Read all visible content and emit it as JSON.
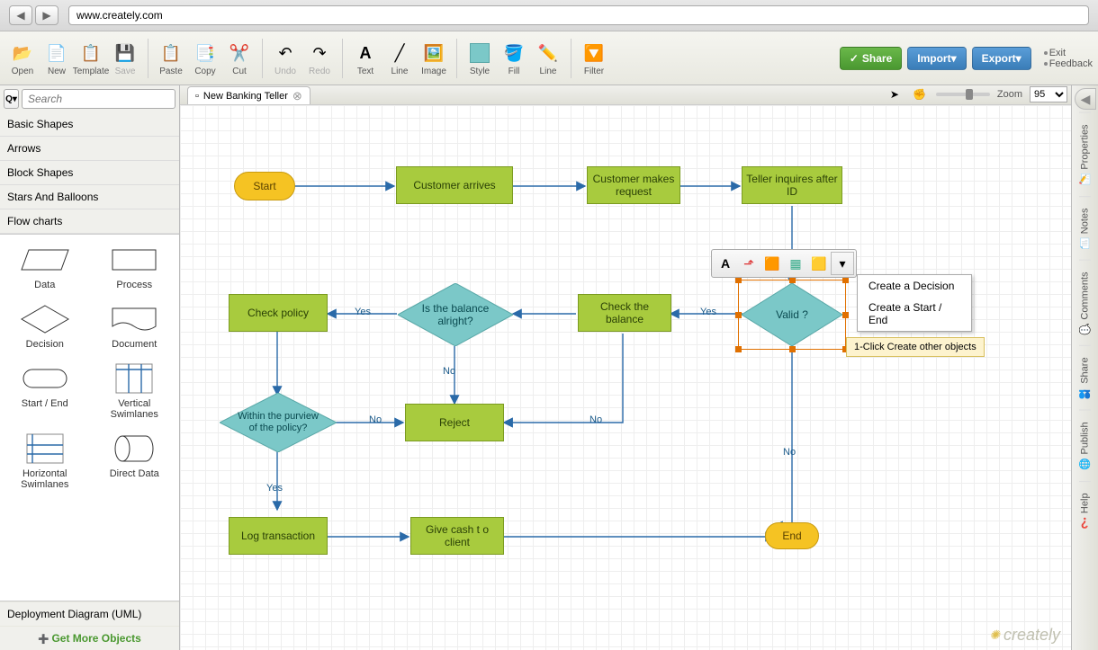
{
  "browser": {
    "url": "www.creately.com"
  },
  "toolbar": {
    "open": "Open",
    "new": "New",
    "template": "Template",
    "save": "Save",
    "paste": "Paste",
    "copy": "Copy",
    "cut": "Cut",
    "undo": "Undo",
    "redo": "Redo",
    "text": "Text",
    "line": "Line",
    "image": "Image",
    "style": "Style",
    "fill": "Fill",
    "line2": "Line",
    "filter": "Filter",
    "share": "Share",
    "import": "Import",
    "export": "Export",
    "exit": "Exit",
    "feedback": "Feedback"
  },
  "tab": {
    "title": "New Banking Teller"
  },
  "canvasTools": {
    "zoomLabel": "Zoom",
    "zoomValue": "95"
  },
  "search": {
    "placeholder": "Search",
    "prefix": "Q"
  },
  "categories": [
    "Basic Shapes",
    "Arrows",
    "Block Shapes",
    "Stars And Balloons",
    "Flow charts"
  ],
  "shapes": {
    "data": "Data",
    "process": "Process",
    "decision": "Decision",
    "document": "Document",
    "startend": "Start / End",
    "vswim": "Vertical Swimlanes",
    "hswim": "Horizontal Swimlanes",
    "direct": "Direct Data"
  },
  "panelFooter": {
    "deployment": "Deployment Diagram (UML)",
    "getmore": "Get More Objects"
  },
  "nodes": {
    "start": "Start",
    "custArrives": "Customer arrives",
    "custRequest": "Customer makes request",
    "tellerInq": "Teller inquires after ID",
    "valid": "Valid ?",
    "checkBal": "Check the balance",
    "balOk": "Is the balance  alright?",
    "checkPolicy": "Check policy",
    "withinPolicy": "Within the purview  of the policy?",
    "reject": "Reject",
    "logTrans": "Log transaction",
    "giveCash": "Give cash t o client",
    "end": "End"
  },
  "labels": {
    "yes": "Yes",
    "no": "No"
  },
  "contextMenu": {
    "decision": "Create a Decision",
    "startend": "Create a Start / End"
  },
  "tooltip": "1-Click Create other objects",
  "rail": {
    "properties": "Properties",
    "notes": "Notes",
    "comments": "Comments",
    "share": "Share",
    "publish": "Publish",
    "help": "Help"
  },
  "watermark": "creately"
}
